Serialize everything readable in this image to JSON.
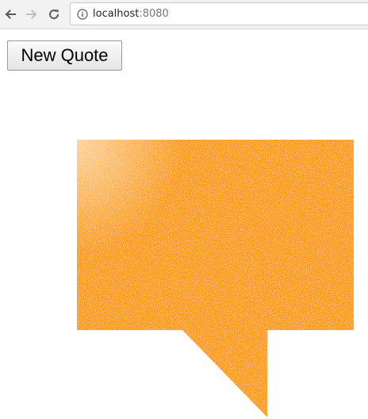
{
  "browser": {
    "url_host": "localhost",
    "url_port": ":8080",
    "icons": {
      "back": "arrow-left-icon",
      "forward": "arrow-right-icon",
      "reload": "reload-icon",
      "site_info": "info-icon"
    }
  },
  "page": {
    "new_quote_label": "New Quote",
    "bubble_color": "#ff9a10"
  }
}
